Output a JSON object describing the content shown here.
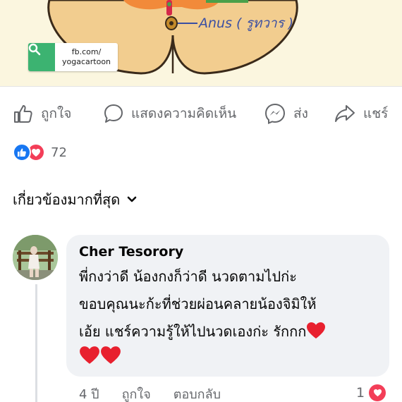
{
  "post_image": {
    "anatomy_label": "Anus ( รูทวาร )",
    "watermark": {
      "line1": "fb.com/",
      "line2": "yogacartoon"
    }
  },
  "actions": {
    "like": "ถูกใจ",
    "comment": "แสดงความคิดเห็น",
    "send": "ส่ง",
    "share": "แชร์"
  },
  "reactions": {
    "count": "72",
    "types": [
      "like",
      "love"
    ]
  },
  "sort": {
    "label": "เกี่ยวข้องมากที่สุด"
  },
  "comment": {
    "author": "Cher Tesorory",
    "text": "พี่กงว่าดี น้องกงก็ว่าดี นวดตามไปก่ะ ขอบคุณนะก้ะที่ช่วยผ่อนคลายน้องจิมิให้เอ้ย แชร์ความรู้ให้ไปนวดเองก่ะ รักกก",
    "line1": "พี่กงว่าดี น้องกงก็ว่าดี นวดตามไปก่ะ",
    "line2": "ขอบคุณนะก้ะที่ช่วยผ่อนคลายน้องจิมิให้",
    "line3": "เอ้ย แชร์ความรู้ให้ไปนวดเองก่ะ รักกก",
    "age": "4 ปี",
    "like_label": "ถูกใจ",
    "reply_label": "ตอบกลับ",
    "like_count": "1"
  },
  "colors": {
    "accent_blue": "#1877f2",
    "love_red": "#f33e58",
    "muted_text": "#65676b",
    "bubble_bg": "#f0f2f5"
  }
}
